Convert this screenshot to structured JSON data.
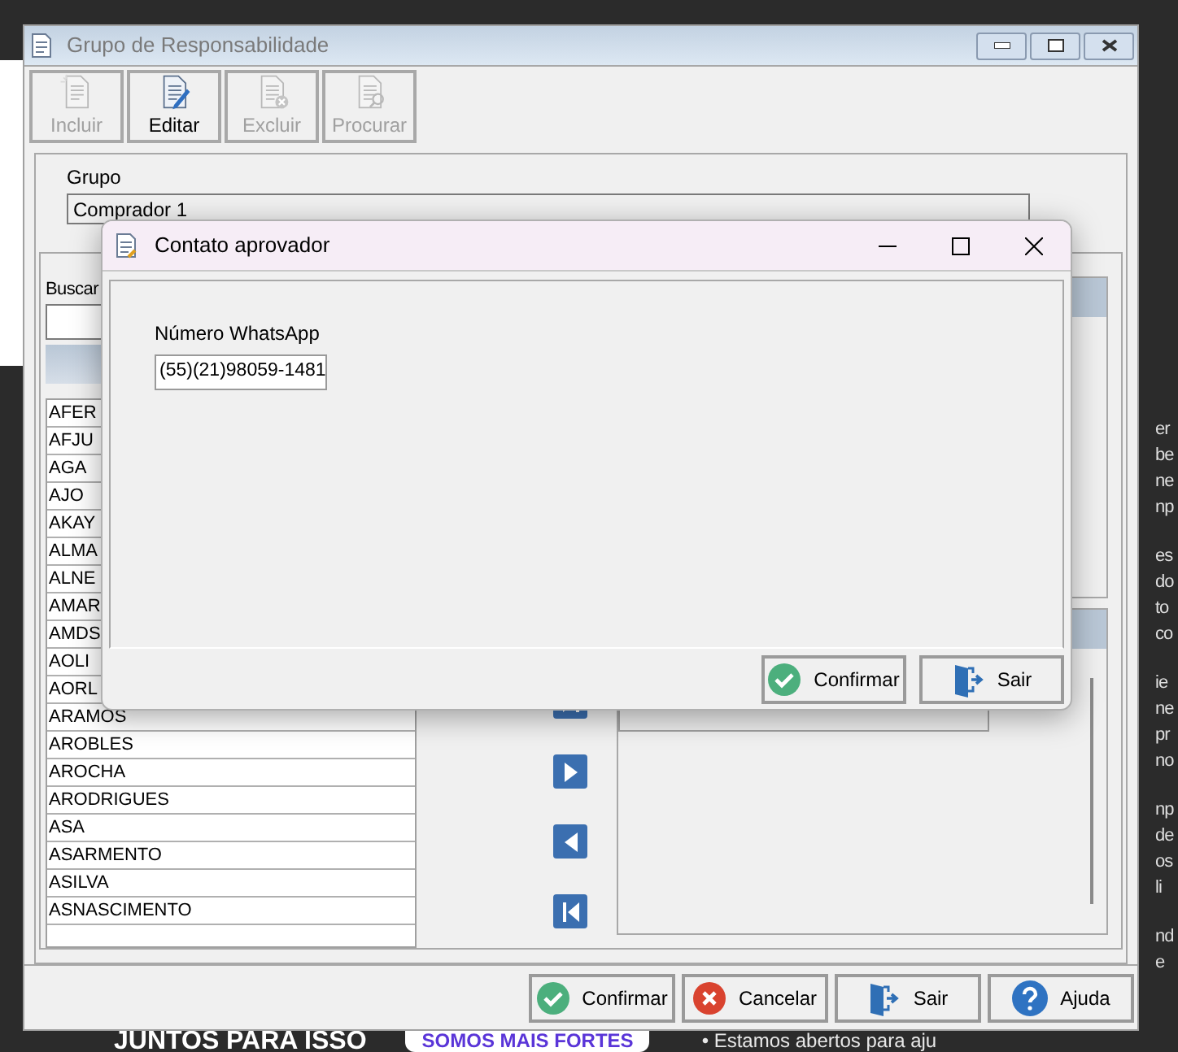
{
  "background_page": {
    "right_fragments": [
      "er",
      "be",
      "ne",
      "np",
      "es",
      "do",
      "to",
      "co",
      "ie",
      "ne",
      "pr",
      "no",
      "np",
      "de",
      "os",
      "li",
      "nd",
      "e"
    ],
    "bottom_texts": [
      {
        "kind": "heading",
        "text": "JUNTOS PARA ISSO"
      },
      {
        "kind": "badge",
        "text": "SOMOS MAIS FORTES"
      },
      {
        "kind": "bullet",
        "text": "• Estamos abertos para aju"
      }
    ]
  },
  "window": {
    "title": "Grupo de Responsabilidade",
    "active": false
  },
  "toolbar": [
    {
      "label": "Incluir",
      "kind": "new",
      "disabled": true
    },
    {
      "label": "Editar",
      "kind": "edit",
      "disabled": false
    },
    {
      "label": "Excluir",
      "kind": "delete",
      "disabled": true
    },
    {
      "label": "Procurar",
      "kind": "search",
      "disabled": true
    }
  ],
  "group": {
    "label": "Grupo",
    "value": "Comprador 1"
  },
  "search": {
    "label": "Buscar"
  },
  "users": [
    "AFER",
    "AFJU",
    "AGA",
    "AJO",
    "AKAY",
    "ALMA",
    "ALNE",
    "AMAR",
    "AMDS",
    "AOLI",
    "AORL",
    "ARAMOS",
    "AROBLES",
    "AROCHA",
    "ARODRIGUES",
    "ASA",
    "ASARMENTO",
    "ASILVA",
    "ASNASCIMENTO"
  ],
  "move_buttons": [
    {
      "kind": "add_all"
    },
    {
      "kind": "add"
    },
    {
      "kind": "remove"
    },
    {
      "kind": "remove_all"
    }
  ],
  "buttons": [
    {
      "label": "Confirmar",
      "kind": "confirm"
    },
    {
      "label": "Cancelar",
      "kind": "cancel"
    },
    {
      "label": "Sair",
      "kind": "exit"
    },
    {
      "label": "Ajuda",
      "kind": "help"
    }
  ],
  "dialog": {
    "title": "Contato aprovador",
    "field_label": "Número WhatsApp",
    "field_value": "(55)(21)98059-1481",
    "buttons": [
      {
        "label": "Confirmar",
        "kind": "confirm"
      },
      {
        "label": "Sair",
        "kind": "exit"
      }
    ]
  }
}
